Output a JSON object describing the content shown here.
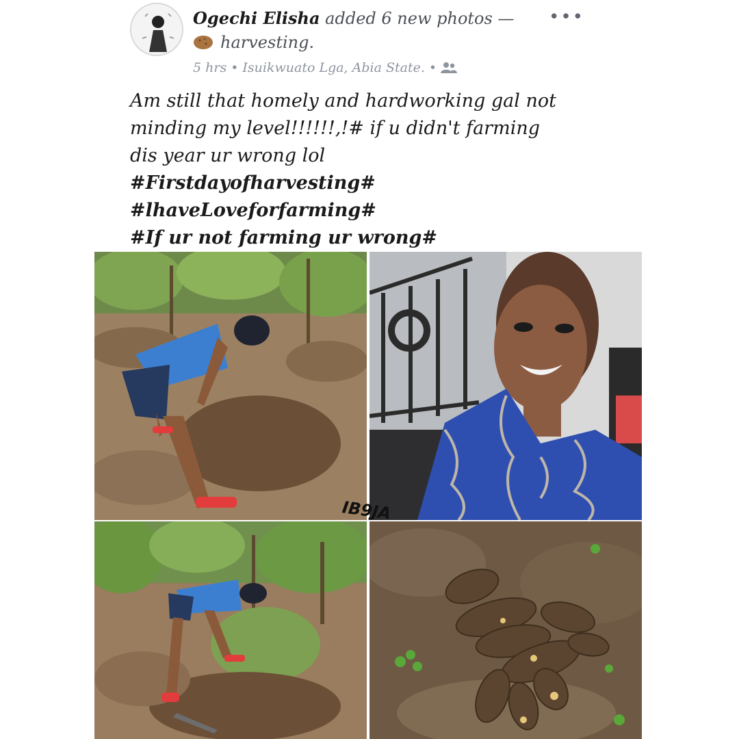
{
  "post": {
    "author": "Ogechi Elisha",
    "action": " added 6 new photos —",
    "feeling": "harvesting.",
    "feeling_icon": "potato-icon",
    "time": "5 hrs",
    "separator": "•",
    "location": "Isuikwuato Lga, Abia State.",
    "audience_icon": "friends-icon",
    "more_label": "•••",
    "text_lines": [
      "Am still that homely and hardworking gal not",
      "minding my level!!!!!!,!#  if u didn't farming",
      "dis year ur wrong lol"
    ],
    "hashtags": [
      "#Firstdayofharvesting#",
      "#lhaveLoveforfarming#",
      "#If ur not farming ur wrong#"
    ]
  },
  "watermark": "IB9JA",
  "colors": {
    "meta_gray": "#8d949e",
    "action_gray": "#4b4f56",
    "soil": "#7a5a3e",
    "dress_blue": "#2e4fb0"
  }
}
